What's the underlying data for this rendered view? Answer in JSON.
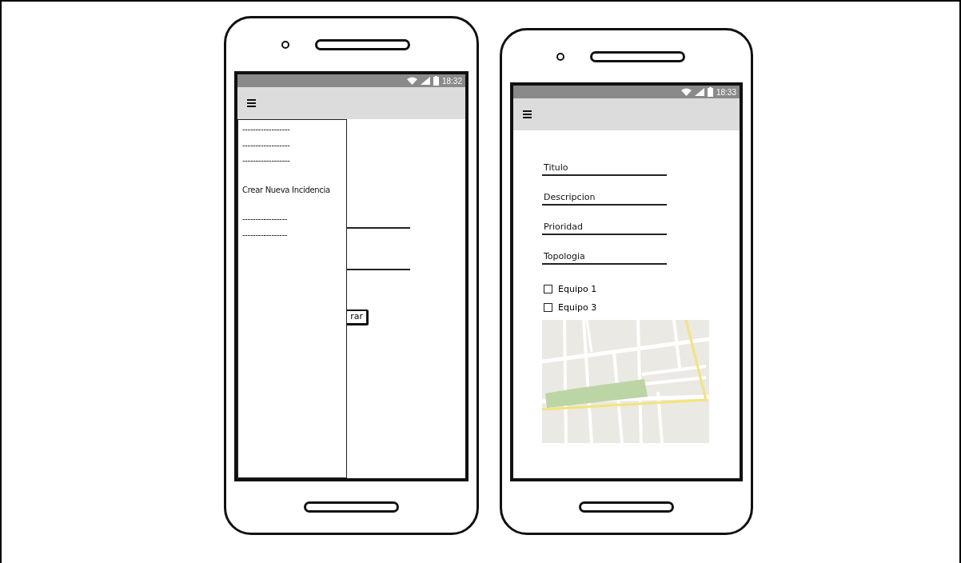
{
  "left_phone": {
    "status_bar": {
      "time": "18:32"
    },
    "drawer": {
      "items": [
        {
          "label": "------------------"
        },
        {
          "label": "------------------"
        },
        {
          "label": "------------------"
        },
        {
          "label": "Crear Nueva Incidencia"
        },
        {
          "label": "-----------------"
        },
        {
          "label": "-----------------"
        }
      ]
    },
    "button": {
      "label": "rar"
    }
  },
  "right_phone": {
    "status_bar": {
      "time": "18:33"
    },
    "fields": [
      {
        "label": "Titulo"
      },
      {
        "label": "Descripcion"
      },
      {
        "label": "Prioridad"
      },
      {
        "label": "Topologia"
      }
    ],
    "checkboxes": [
      {
        "label": "Equipo 1",
        "checked": false
      },
      {
        "label": "Equipo 3",
        "checked": false
      }
    ]
  }
}
